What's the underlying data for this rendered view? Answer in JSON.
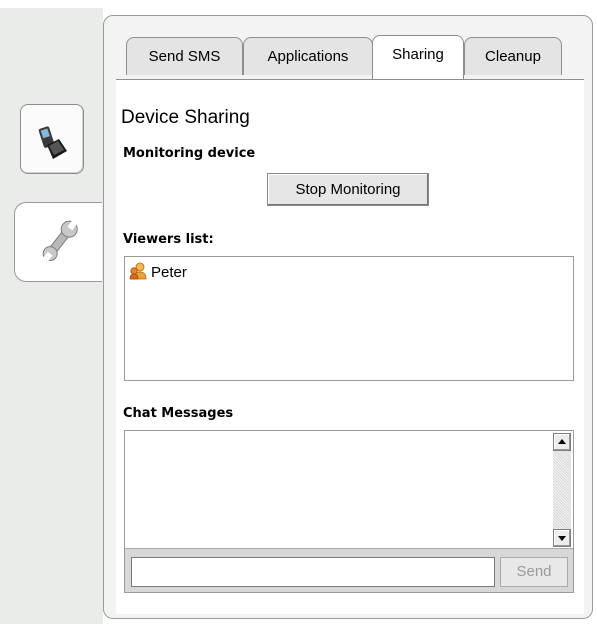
{
  "tabs": [
    {
      "label": "Send SMS",
      "active": false
    },
    {
      "label": "Applications",
      "active": false
    },
    {
      "label": "Sharing",
      "active": true
    },
    {
      "label": "Cleanup",
      "active": false
    }
  ],
  "sidebar": {
    "items": [
      {
        "icon": "mobile-phone-icon",
        "active": false
      },
      {
        "icon": "wrench-icon",
        "active": true
      }
    ]
  },
  "sharing": {
    "title": "Device Sharing",
    "monitoring_label": "Monitoring device",
    "stop_button": "Stop Monitoring",
    "viewers_label": "Viewers list:",
    "viewers": [
      {
        "name": "Peter",
        "icon": "user-icon"
      }
    ],
    "chat_label": "Chat Messages",
    "chat_input_value": "",
    "send_button": "Send"
  },
  "colors": {
    "panel_border": "#9a9a9a",
    "side_background": "#e9ece9",
    "send_disabled_text": "#9a9a9a"
  }
}
